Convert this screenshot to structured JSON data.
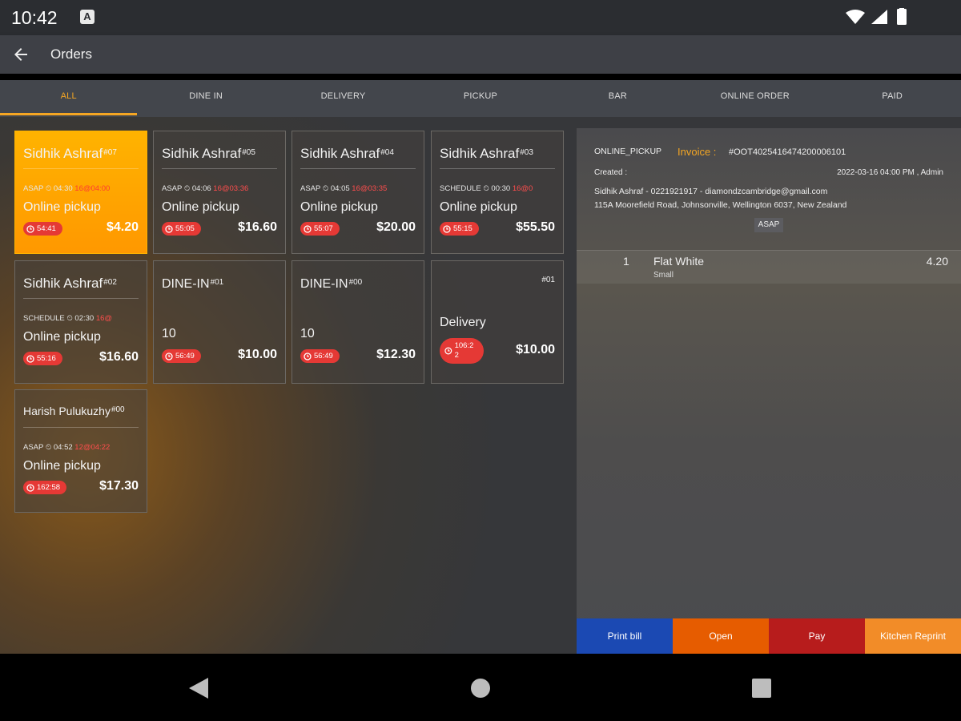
{
  "status": {
    "time": "10:42",
    "app_badge": "A"
  },
  "app_bar": {
    "title": "Orders"
  },
  "tabs": [
    {
      "label": "ALL",
      "active": true
    },
    {
      "label": "DINE IN"
    },
    {
      "label": "DELIVERY"
    },
    {
      "label": "PICKUP"
    },
    {
      "label": "BAR"
    },
    {
      "label": "ONLINE ORDER"
    },
    {
      "label": "PAID"
    }
  ],
  "orders": [
    {
      "name": "Sidhik Ashraf",
      "num": "#07",
      "meta": "ASAP ⏲ 04:30 ",
      "meta_red": "16@04:00",
      "type": "Online pickup",
      "timer": "54:41",
      "price": "$4.20"
    },
    {
      "name": "Sidhik Ashraf",
      "num": "#05",
      "meta": "ASAP ⏲ 04:06 ",
      "meta_red": "16@03:36",
      "type": "Online pickup",
      "timer": "55:05",
      "price": "$16.60"
    },
    {
      "name": "Sidhik Ashraf",
      "num": "#04",
      "meta": "ASAP ⏲ 04:05 ",
      "meta_red": "16@03:35",
      "type": "Online pickup",
      "timer": "55:07",
      "price": "$20.00"
    },
    {
      "name": "Sidhik Ashraf",
      "num": "#03",
      "meta": "SCHEDULE ⏲ 00:30 ",
      "meta_red": "16@0",
      "type": "Online pickup",
      "timer": "55:15",
      "price": "$55.50"
    },
    {
      "name": "Sidhik Ashraf",
      "num": "#02",
      "meta": "SCHEDULE ⏲ 02:30 ",
      "meta_red": "16@",
      "type": "Online pickup",
      "timer": "55:16",
      "price": "$16.60"
    },
    {
      "name": "DINE-IN",
      "num": "#01",
      "table": "10",
      "timer": "56:49",
      "price": "$10.00"
    },
    {
      "name": "DINE-IN",
      "num": "#00",
      "table": "10",
      "timer": "56:49",
      "price": "$12.30"
    },
    {
      "name": "",
      "num": "#01",
      "type": "Delivery",
      "timer": "106:2 2",
      "price": "$10.00"
    },
    {
      "name": "Harish Pulukuzhy",
      "num": "#00",
      "meta": "ASAP ⏲ 04:52 ",
      "meta_red": "12@04:22",
      "type": "Online pickup",
      "timer": "162:58",
      "price": "$17.30"
    }
  ],
  "detail": {
    "source": "ONLINE_PICKUP",
    "invoice_label": "Invoice :",
    "invoice_no": "#OOT4025416474200006101",
    "created_label": "Created :",
    "created_value": "2022-03-16 04:00 PM , Admin",
    "customer": "Sidhik Ashraf - 0221921917 - diamondzcambridge@gmail.com",
    "address": "115A Moorefield Road, Johnsonville, Wellington 6037, New Zealand",
    "badge": "ASAP",
    "items": [
      {
        "qty": "1",
        "name": "Flat White",
        "modifier": "Small",
        "price": "4.20"
      }
    ]
  },
  "actions": [
    {
      "label": "Print bill",
      "color": "#1b49b3"
    },
    {
      "label": "Open",
      "color": "#e65c00"
    },
    {
      "label": "Pay",
      "color": "#b71c1c"
    },
    {
      "label": "Kitchen Reprint",
      "color": "#f28c28"
    }
  ],
  "colors": {
    "accent": "#f5a623",
    "timer": "#e53935",
    "selected_card": "#ffa000"
  }
}
